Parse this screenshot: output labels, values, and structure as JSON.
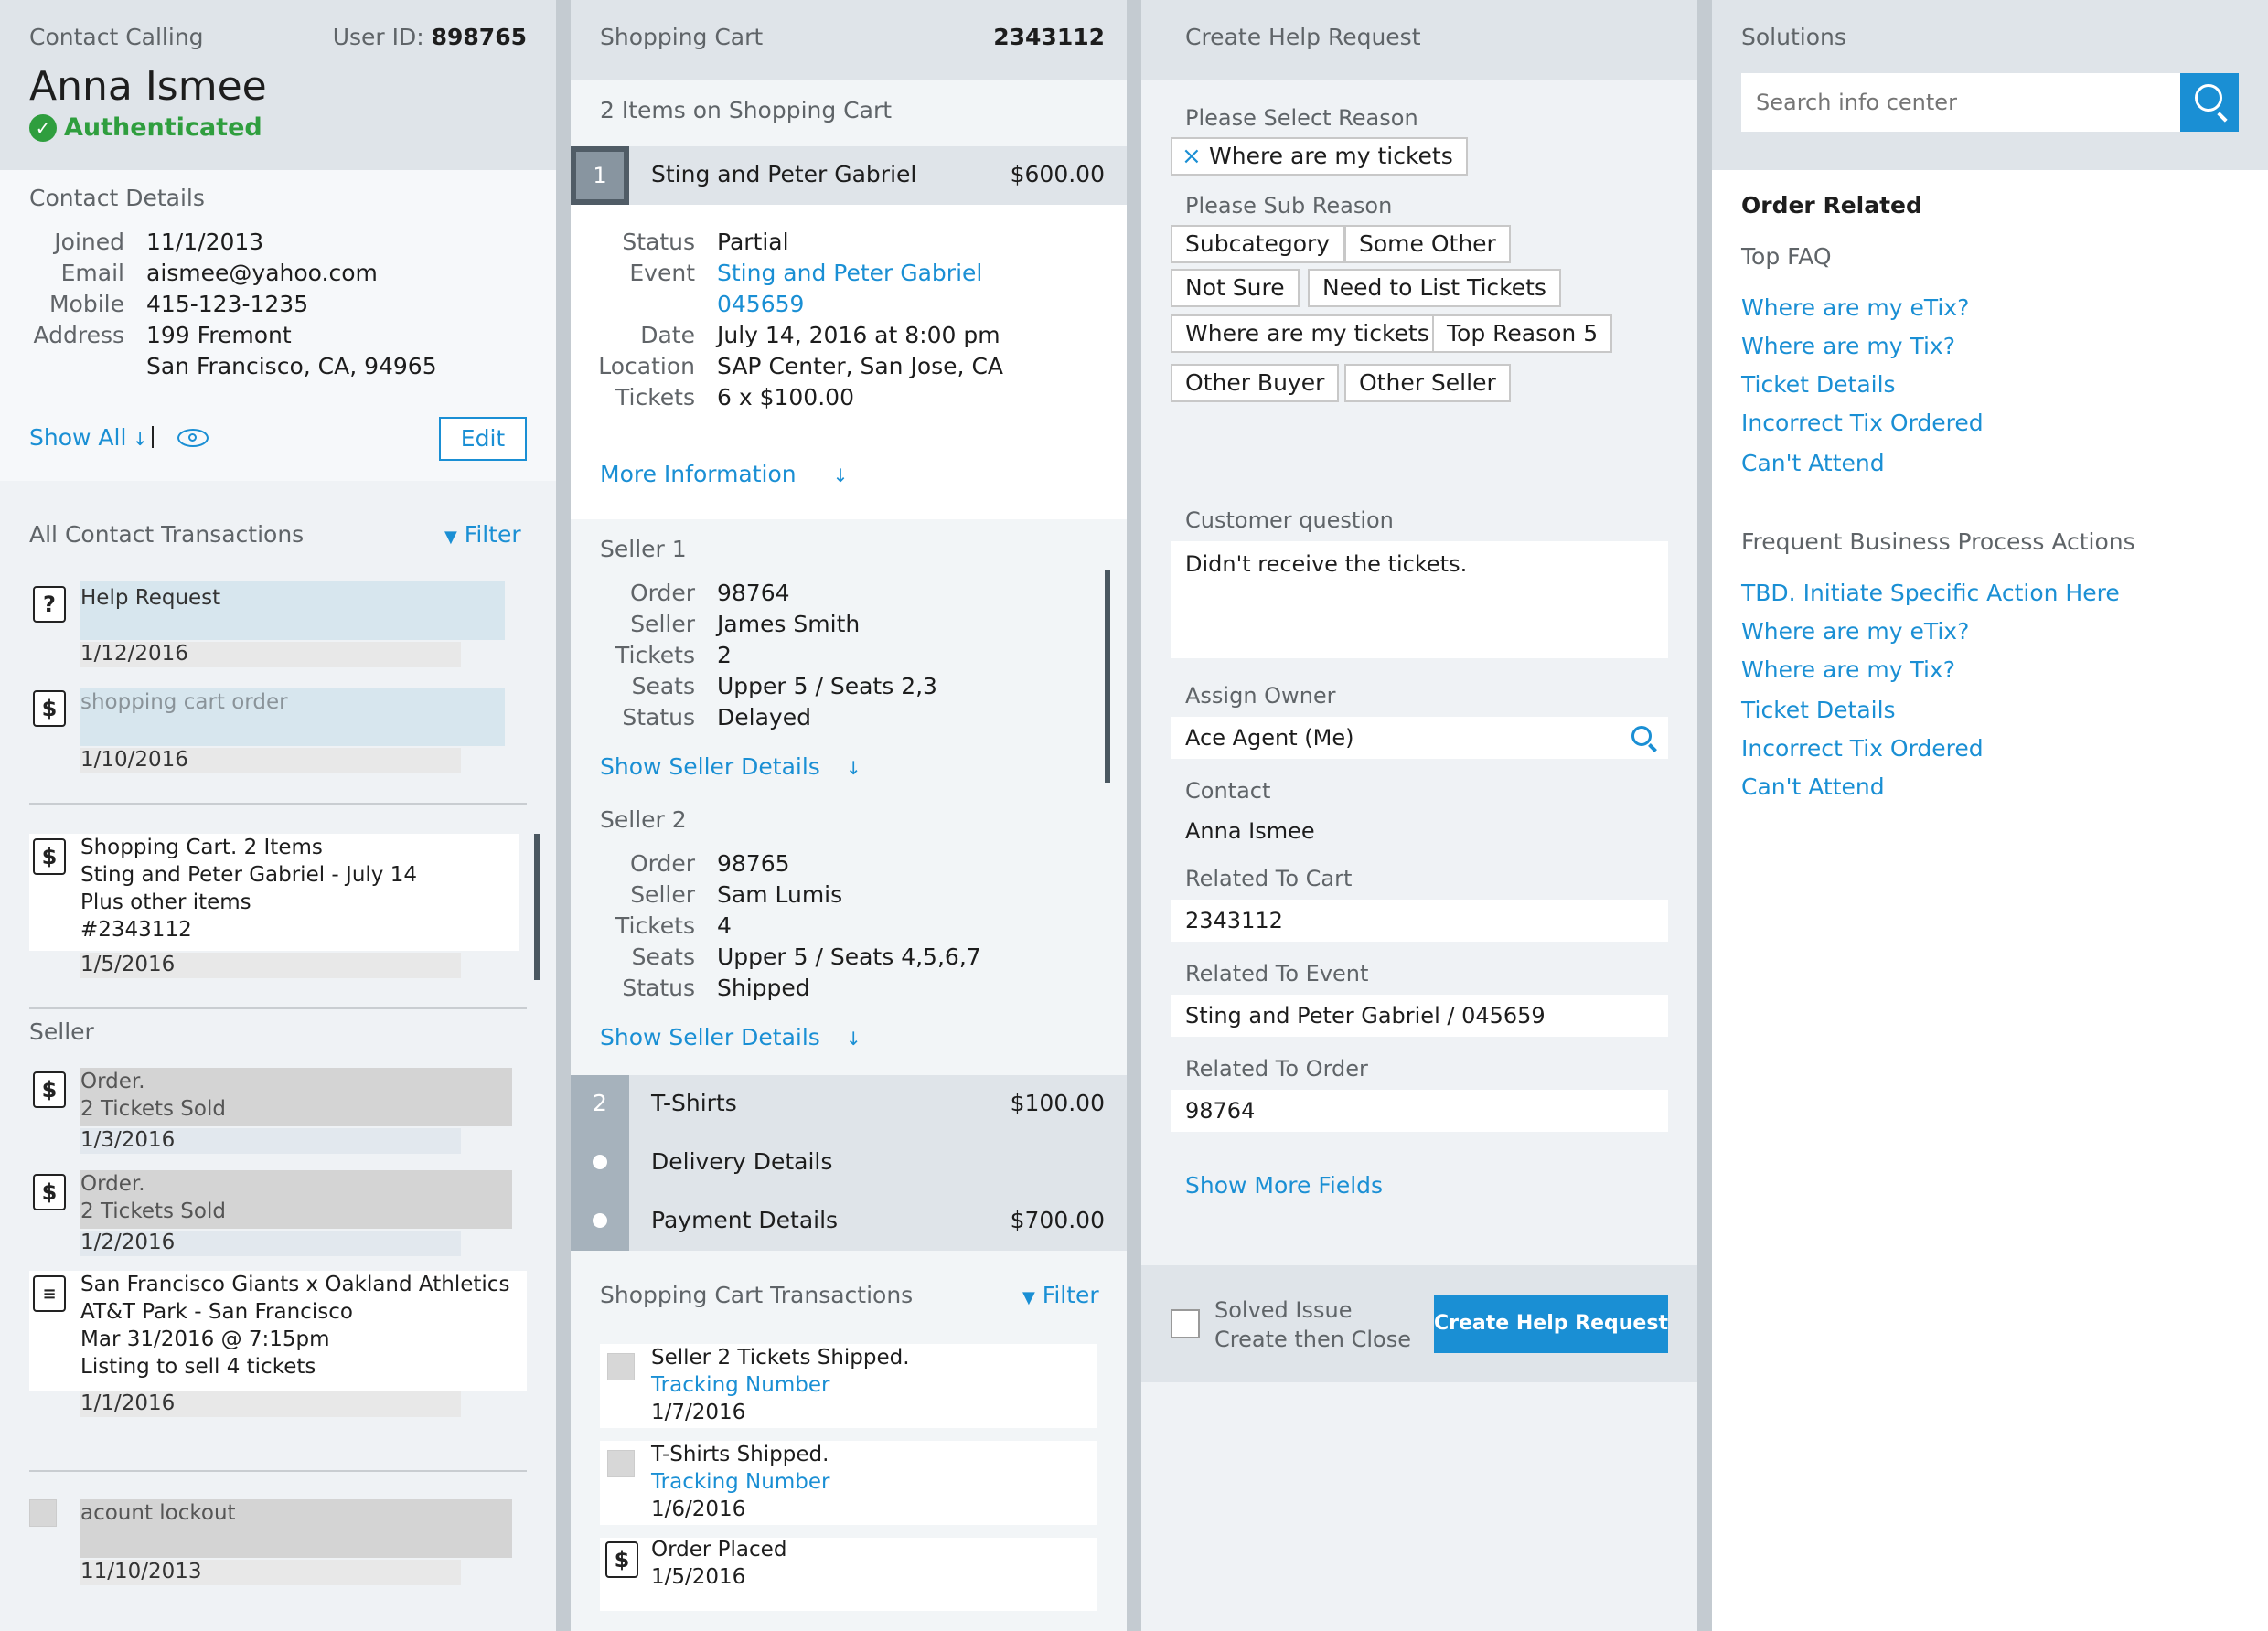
{
  "contact": {
    "title": "Contact Calling",
    "user_id_label": "User ID:",
    "user_id": "898765",
    "name": "Anna Ismee",
    "status": "Authenticated",
    "details_title": "Contact Details",
    "fields": [
      {
        "label": "Joined",
        "value": "11/1/2013"
      },
      {
        "label": "Email",
        "value": "aismee@yahoo.com"
      },
      {
        "label": "Mobile",
        "value": "415-123-1235"
      },
      {
        "label": "Address",
        "value": "199 Fremont"
      }
    ],
    "address_line2": "San Francisco, CA, 94965",
    "show_all": "Show All",
    "edit": "Edit",
    "transactions_title": "All Contact Transactions",
    "filter": "Filter",
    "help_request": "Help Request",
    "help_request_date": "1/12/2016",
    "shopping_cart_order": "shopping cart order",
    "shopping_cart_order_date": "1/10/2016",
    "cart_lines": [
      "Shopping Cart. 2 Items",
      "Sting and Peter Gabriel - July 14",
      "Plus other items",
      "#2343112"
    ],
    "cart_date": "1/5/2016",
    "seller_title": "Seller",
    "order1_lines": [
      "Order.",
      "2 Tickets Sold"
    ],
    "order1_date": "1/3/2016",
    "order2_lines": [
      "Order.",
      "2 Tickets Sold"
    ],
    "order2_date": "1/2/2016",
    "listing_lines": [
      "San Francisco Giants x Oakland Athletics",
      "AT&T Park - San Francisco",
      "Mar 31/2016 @ 7:15pm",
      "Listing to sell 4 tickets"
    ],
    "listing_date": "1/1/2016",
    "lockout": "acount lockout",
    "lockout_date": "11/10/2013"
  },
  "cart": {
    "title": "Shopping Cart",
    "cart_id": "2343112",
    "items_count": "2 Items on Shopping Cart",
    "item1_num": "1",
    "item1_name": "Sting and Peter Gabriel",
    "item1_price": "$600.00",
    "status_label": "Status",
    "status": "Partial",
    "event_label": "Event",
    "event_name": "Sting and Peter Gabriel",
    "event_id": "045659",
    "date_label": "Date",
    "date": "July 14, 2016 at 8:00 pm",
    "location_label": "Location",
    "location": "SAP Center, San Jose, CA",
    "tickets_label": "Tickets",
    "tickets": "6 x $100.00",
    "more_info": "More Information",
    "seller1_title": "Seller 1",
    "seller1": [
      {
        "label": "Order",
        "value": "98764"
      },
      {
        "label": "Seller",
        "value": "James Smith"
      },
      {
        "label": "Tickets",
        "value": "2"
      },
      {
        "label": "Seats",
        "value": "Upper 5 / Seats 2,3"
      },
      {
        "label": "Status",
        "value": "Delayed"
      }
    ],
    "show_seller_details": "Show Seller Details",
    "seller2_title": "Seller 2",
    "seller2": [
      {
        "label": "Order",
        "value": "98765"
      },
      {
        "label": "Seller",
        "value": "Sam Lumis"
      },
      {
        "label": "Tickets",
        "value": "4"
      },
      {
        "label": "Seats",
        "value": "Upper 5 / Seats 4,5,6,7"
      },
      {
        "label": "Status",
        "value": "Shipped"
      }
    ],
    "item2_num": "2",
    "item2_name": "T-Shirts",
    "item2_price": "$100.00",
    "delivery": "Delivery Details",
    "payment": "Payment Details",
    "payment_total": "$700.00",
    "tx_title": "Shopping Cart Transactions",
    "filter": "Filter",
    "tx1_title": "Seller 2 Tickets Shipped.",
    "tx1_link": "Tracking Number",
    "tx1_date": "1/7/2016",
    "tx2_title": "T-Shirts Shipped.",
    "tx2_link": "Tracking Number",
    "tx2_date": "1/6/2016",
    "tx3_title": "Order Placed",
    "tx3_date": "1/5/2016"
  },
  "help": {
    "title": "Create Help Request",
    "reason_label": "Please Select Reason",
    "reason_selected": "Where are my tickets",
    "sub_reason_label": "Please Sub Reason",
    "sub_reasons": [
      "Subcategory",
      "Some Other",
      "Not Sure",
      "Need to List Tickets",
      "Where are my tickets",
      "Top Reason 5",
      "Other Buyer",
      "Other Seller"
    ],
    "question_label": "Customer question",
    "question_value": "Didn't receive the tickets.",
    "owner_label": "Assign Owner",
    "owner_value": "Ace Agent (Me)",
    "contact_label": "Contact",
    "contact_value": "Anna Ismee",
    "cart_label": "Related To Cart",
    "cart_value": "2343112",
    "event_label": "Related To Event",
    "event_value": "Sting and Peter Gabriel / 045659",
    "order_label": "Related To Order",
    "order_value": "98764",
    "show_more": "Show More Fields",
    "solved_line1": "Solved Issue",
    "solved_line2": "Create then Close",
    "create_button": "Create Help Request"
  },
  "solutions": {
    "title": "Solutions",
    "search_placeholder": "Search info center",
    "order_related": "Order Related",
    "top_faq": "Top FAQ",
    "faq_links": [
      "Where are my eTix?",
      "Where are my Tix?",
      "Ticket Details",
      "Incorrect Tix Ordered",
      "Can't Attend"
    ],
    "frequent_title": "Frequent Business Process Actions",
    "action_links": [
      "TBD. Initiate Specific Action Here",
      "Where are my eTix?",
      "Where are my Tix?",
      "Ticket Details",
      "Incorrect Tix Ordered",
      "Can't Attend"
    ]
  },
  "colors": {
    "accent": "#1a8fd4",
    "success": "#2f9e3e",
    "panel_header": "#dde3e8",
    "divider": "#c4cbd1"
  }
}
